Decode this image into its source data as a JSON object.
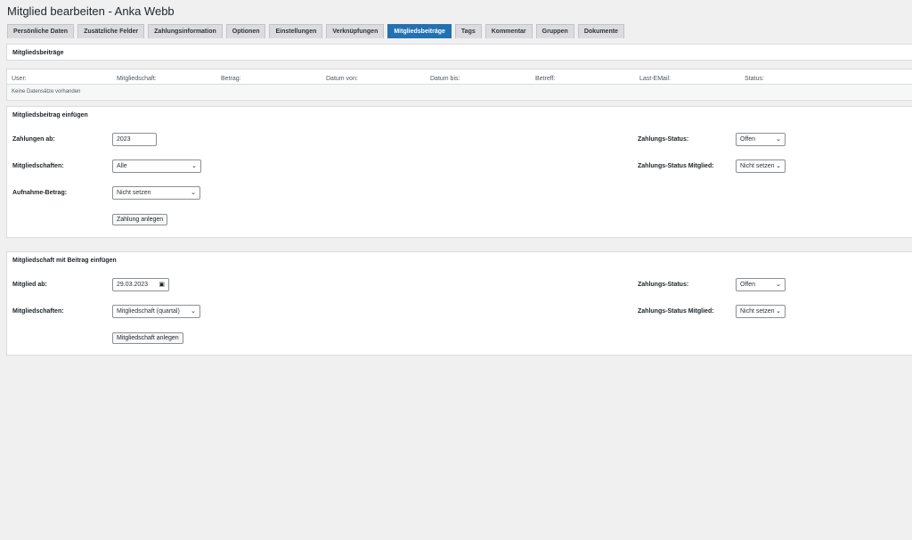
{
  "page": {
    "title": "Mitglied bearbeiten - Anka Webb"
  },
  "tabs": [
    {
      "label": "Persönliche Daten"
    },
    {
      "label": "Zusätzliche Felder"
    },
    {
      "label": "Zahlungsinformation"
    },
    {
      "label": "Optionen"
    },
    {
      "label": "Einstellungen"
    },
    {
      "label": "Verknüpfungen"
    },
    {
      "label": "Mitgliedsbeiträge",
      "active": true
    },
    {
      "label": "Tags"
    },
    {
      "label": "Kommentar"
    },
    {
      "label": "Gruppen"
    },
    {
      "label": "Dokumente"
    }
  ],
  "beitraege": {
    "title": "Mitgliedsbeiträge",
    "columns": [
      "User:",
      "Mitgliedschaft:",
      "Betrag:",
      "Datum von:",
      "Datum bis:",
      "Betreff:",
      "Last-EMail:",
      "Status:"
    ],
    "empty_text": "Keine Datensätze vorhanden"
  },
  "einfuegen": {
    "title": "Mitgliedsbeitrag einfügen",
    "zahlungen_ab_label": "Zahlungen ab:",
    "zahlungen_ab_value": "2023",
    "mitgliedschaften_label": "Mitgliedschaften:",
    "mitgliedschaften_value": "Alle",
    "aufnahme_label": "Aufnahme-Betrag:",
    "aufnahme_value": "Nicht setzen",
    "status_label": "Zahlungs-Status:",
    "status_value": "Offen",
    "status_mitglied_label": "Zahlungs-Status Mitglied:",
    "status_mitglied_value": "Nicht setzen",
    "button_label": "Zahlung anlegen"
  },
  "mitgliedschaft": {
    "title": "Mitgliedschaft mit Beitrag einfügen",
    "mitglied_ab_label": "Mitglied ab:",
    "mitglied_ab_value": "29.03.2023",
    "mitgliedschaften_label": "Mitgliedschaften:",
    "mitgliedschaften_value": "Mitgliedschaft (quartal)",
    "status_label": "Zahlungs-Status:",
    "status_value": "Offen",
    "status_mitglied_label": "Zahlungs-Status Mitglied:",
    "status_mitglied_value": "Nicht setzen",
    "button_label": "Mitgliedschaft anlegen"
  }
}
